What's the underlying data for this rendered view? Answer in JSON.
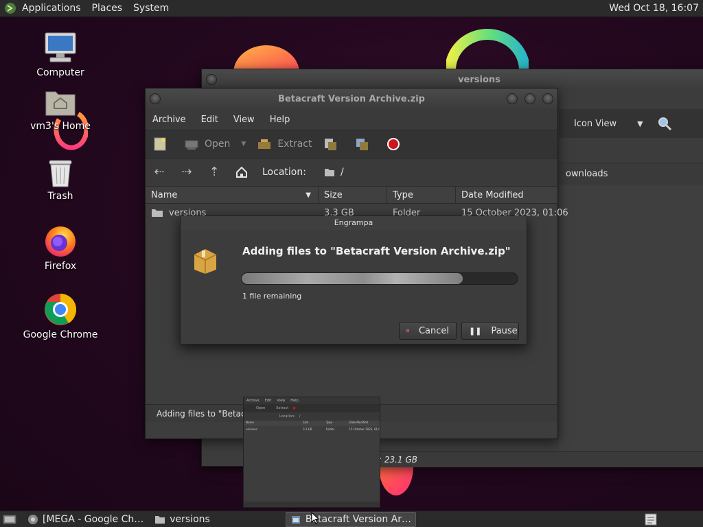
{
  "top_panel": {
    "menus": [
      "Applications",
      "Places",
      "System"
    ],
    "clock": "Wed Oct 18, 16:07"
  },
  "desktop_icons": [
    {
      "label": "Computer",
      "icon": "computer-icon"
    },
    {
      "label": "vm3's Home",
      "icon": "home-folder-icon"
    },
    {
      "label": "Trash",
      "icon": "trash-icon"
    },
    {
      "label": "Firefox",
      "icon": "firefox-icon"
    },
    {
      "label": "Google Chrome",
      "icon": "chrome-icon"
    }
  ],
  "versions_window": {
    "title": "versions",
    "view_mode": "Icon View",
    "location_partial": "ownloads",
    "status_partial": ": 23.1 GB"
  },
  "archive_window": {
    "title": "Betacraft Version Archive.zip",
    "menus": [
      "Archive",
      "Edit",
      "View",
      "Help"
    ],
    "toolbar": {
      "open_label": "Open",
      "extract_label": "Extract"
    },
    "location_label": "Location:",
    "location_value": "/",
    "columns": [
      "Name",
      "Size",
      "Type",
      "Date Modified"
    ],
    "rows": [
      {
        "name": "versions",
        "size": "3.3 GB",
        "type": "Folder",
        "date": "15 October 2023, 01:06"
      }
    ],
    "status": "Adding files to \"Betacraft V"
  },
  "dialog": {
    "title": "Engrampa",
    "heading": "Adding files to \"Betacraft Version Archive.zip\"",
    "progress": 0.8,
    "remaining": "1 file remaining",
    "cancel_label": "Cancel",
    "pause_label": "Pause"
  },
  "taskbar": {
    "items": [
      {
        "label": "[MEGA - Google Ch…",
        "icon": "chrome-icon"
      },
      {
        "label": "versions",
        "icon": "folder-icon"
      },
      {
        "label": "Betacraft Version Ar…",
        "icon": "archive-icon"
      }
    ]
  },
  "colors": {
    "accent_red": "#d0141e",
    "panel_bg": "#2b2b2b"
  }
}
